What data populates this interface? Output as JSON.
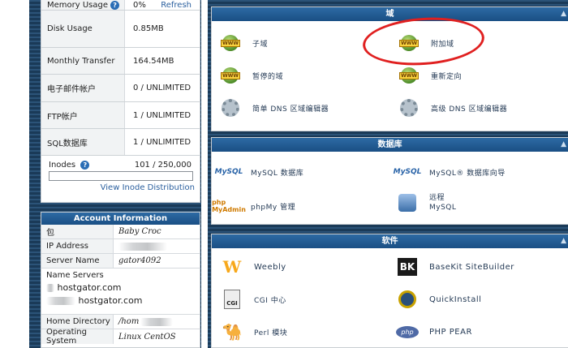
{
  "stats": {
    "memory": {
      "label": "Memory Usage",
      "value": "0%",
      "action": "Refresh"
    },
    "disk": {
      "label": "Disk Usage",
      "value": "0.85MB"
    },
    "transfer": {
      "label": "Monthly Transfer",
      "value": "164.54MB"
    },
    "email": {
      "label": "电子邮件帐户",
      "value": "0 / UNLIMITED"
    },
    "ftp": {
      "label": "FTP帐户",
      "value": "1 / UNLIMITED"
    },
    "sql": {
      "label": "SQL数据库",
      "value": "1 / UNLIMITED"
    },
    "inodes": {
      "label": "Inodes",
      "value": "101 / 250,000",
      "link": "View Inode Distribution",
      "usage_fraction": 0.0004
    }
  },
  "account": {
    "title": "Account Information",
    "rows": [
      {
        "label": "包",
        "value": "Baby Croc"
      },
      {
        "label": "IP Address",
        "value": ""
      },
      {
        "label": "Server Name",
        "value": "gator4092"
      }
    ],
    "name_servers": {
      "label": "Name Servers",
      "ns1": "hostgator.com",
      "ns2": "hostgator.com"
    },
    "home": {
      "label": "Home Directory",
      "value": "/hom"
    },
    "os": {
      "label": "Operating System",
      "value": "Linux CentOS"
    }
  },
  "domains": {
    "title": "域",
    "items": [
      {
        "label": "子域",
        "icon": "www-double-icon"
      },
      {
        "label": "附加域",
        "icon": "www-add-icon"
      },
      {
        "label": "暂停的域",
        "icon": "www-parked-icon"
      },
      {
        "label": "重新定向",
        "icon": "www-redirect-icon"
      },
      {
        "label": "简单 DNS 区域编辑器",
        "icon": "dns-gear-icon"
      },
      {
        "label": "高级 DNS 区域编辑器",
        "icon": "dns-gear-advanced-icon"
      }
    ]
  },
  "databases": {
    "title": "数据库",
    "items": [
      {
        "label": "MySQL 数据库",
        "icon": "mysql-icon"
      },
      {
        "label": "MySQL® 数据库向导",
        "icon": "mysql-wizard-icon"
      },
      {
        "label": "phpMy 管理",
        "icon": "phpmyadmin-icon"
      },
      {
        "label": "远程",
        "label2": "MySQL",
        "icon": "remote-mysql-icon"
      }
    ]
  },
  "software": {
    "title": "软件",
    "items": [
      {
        "label": "Weebly",
        "icon": "weebly-icon"
      },
      {
        "label": "BaseKit SiteBuilder",
        "icon": "basekit-icon"
      },
      {
        "label": "CGI 中心",
        "icon": "cgi-icon"
      },
      {
        "label": "QuickInstall",
        "icon": "quickinstall-icon"
      },
      {
        "label": "Perl 模块",
        "icon": "perl-icon"
      },
      {
        "label": "PHP PEAR",
        "icon": "php-icon"
      }
    ]
  },
  "glyphs": {
    "help": "?",
    "collapse": "▲",
    "www": "WWW",
    "mysql": "MySQL",
    "weebly": "W",
    "basekit": "BK",
    "php": "php",
    "cgi": "CGI",
    "camel": "🐪",
    "phpmy": "php MyAdmin"
  },
  "colors": {
    "header": "#1a4f84",
    "link": "#2a5f9e",
    "annotation": "#e02020"
  }
}
